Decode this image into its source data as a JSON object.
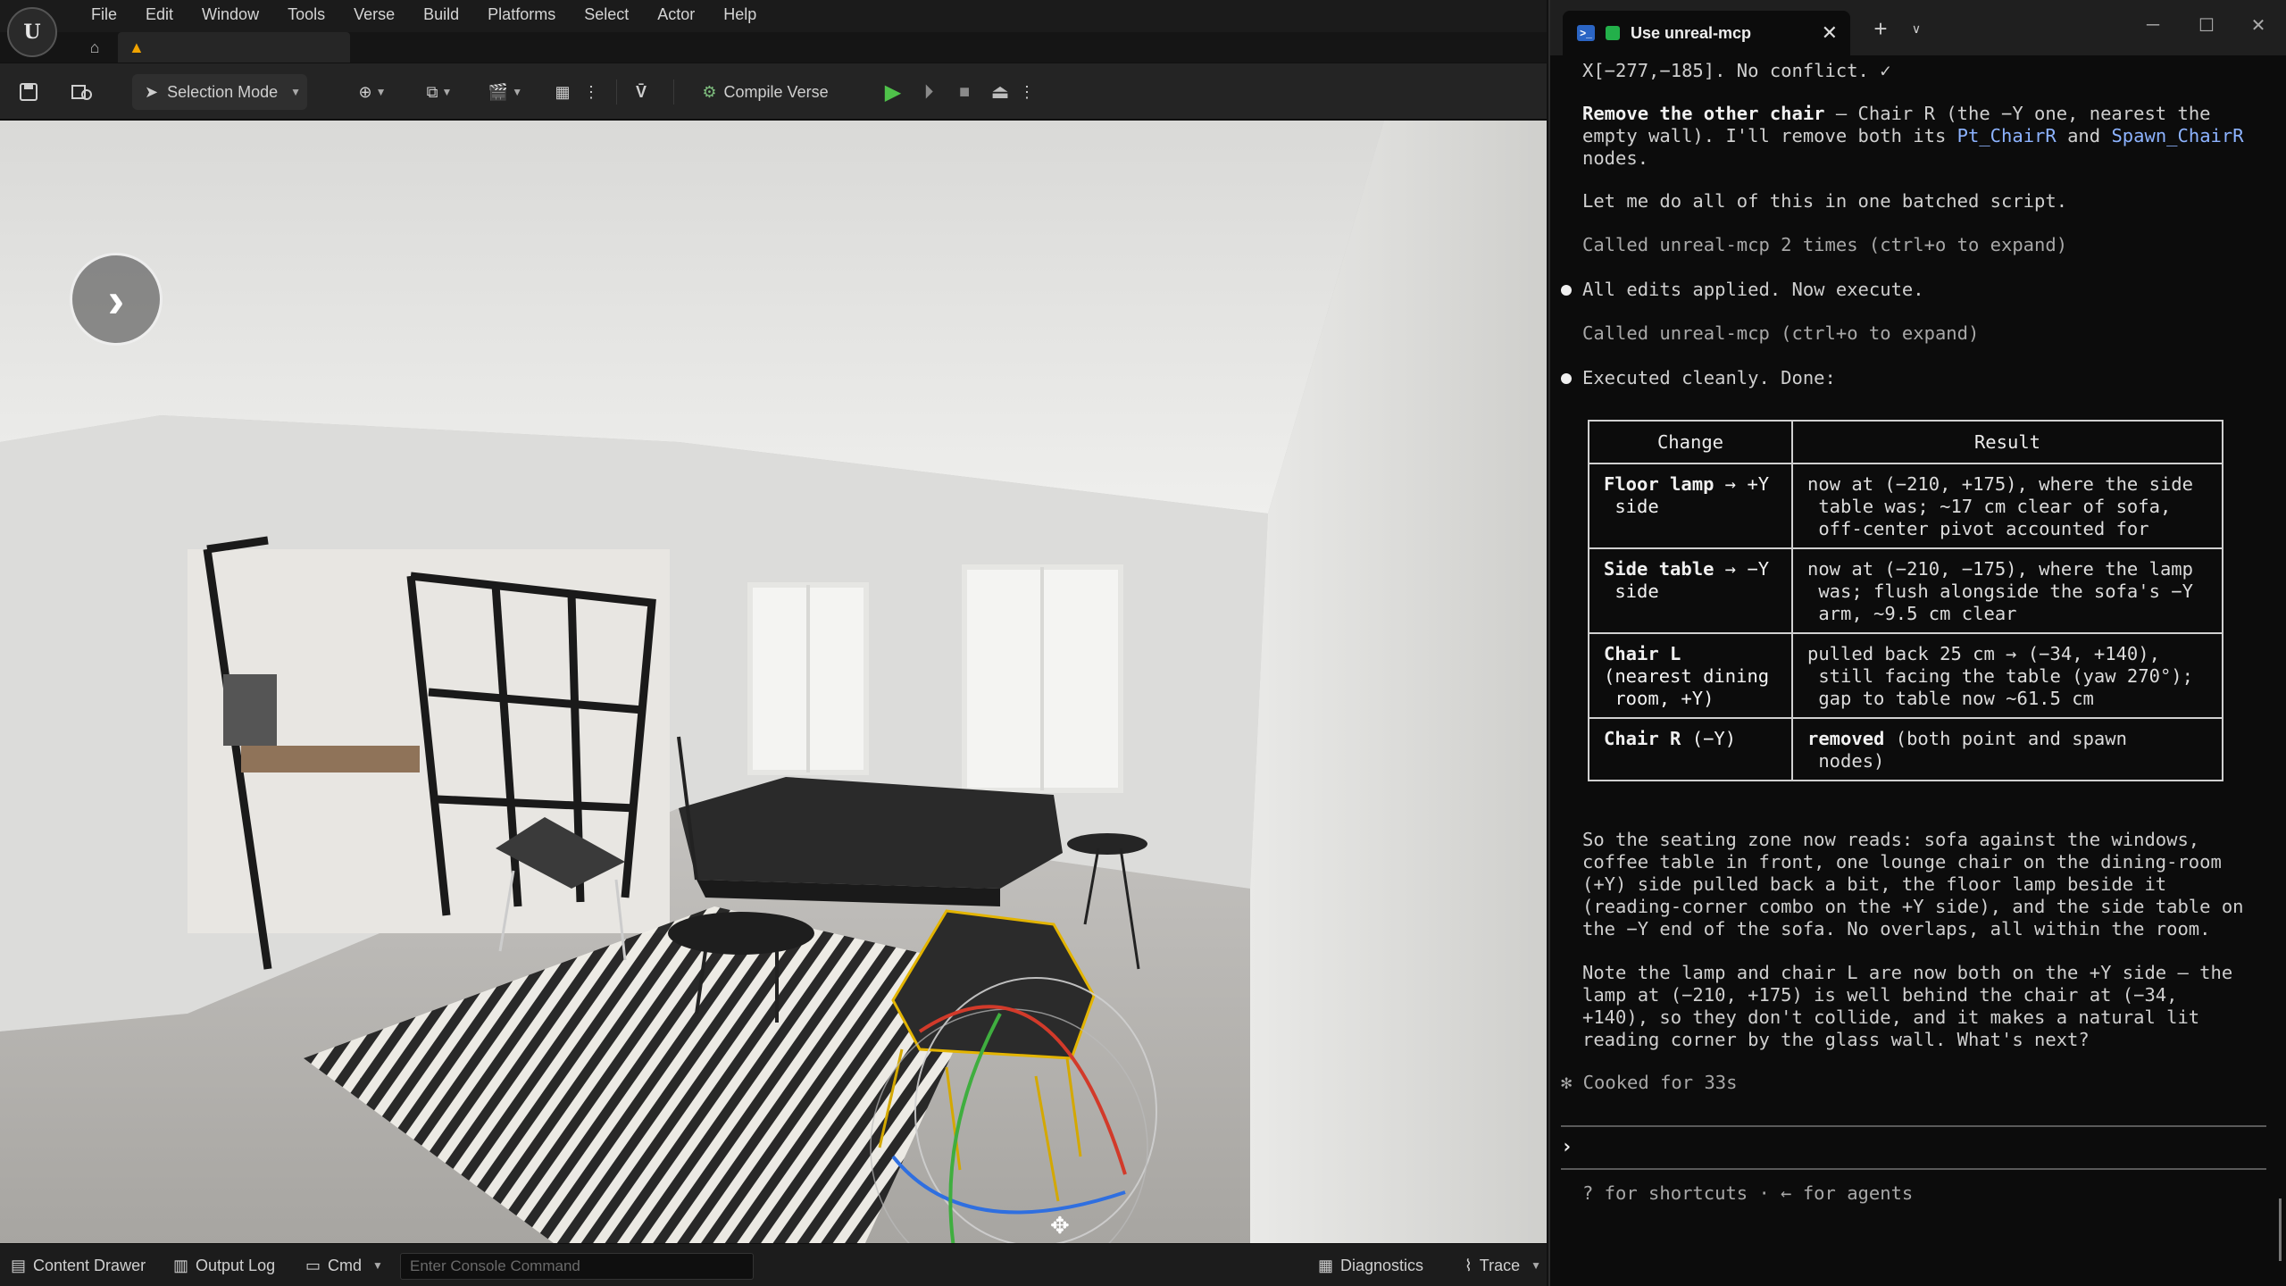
{
  "editor": {
    "logo_text": "U",
    "menu": [
      "File",
      "Edit",
      "Window",
      "Tools",
      "Verse",
      "Build",
      "Platforms",
      "Select",
      "Actor",
      "Help"
    ],
    "toolbar": {
      "selection_mode": "Selection Mode",
      "compile_verse": "Compile Verse"
    },
    "statusbar": {
      "content_drawer": "Content Drawer",
      "output_log": "Output Log",
      "cmd": "Cmd",
      "console_placeholder": "Enter Console Command",
      "diagnostics": "Diagnostics",
      "trace": "Trace"
    }
  },
  "terminal": {
    "tab_title": "Use unreal-mcp",
    "lines": {
      "l0": "X[−277,−185]. No conflict. ✓",
      "p1_head": "Remove the other chair",
      "p1_a": " — Chair R (the −Y one, nearest the",
      "p1_b_pre": "empty wall). I'll remove both its ",
      "p1_b_link1": "Pt_ChairR",
      "p1_b_mid": " and ",
      "p1_b_link2": "Spawn_ChairR",
      "p1_c": "nodes.",
      "p2": "Let me do all of this in one batched script.",
      "called1": "Called unreal-mcp 2 times (ctrl+o to expand)",
      "applied": "All edits applied. Now execute.",
      "called2": "Called unreal-mcp (ctrl+o to expand)",
      "executed": "Executed cleanly. Done:"
    },
    "table": {
      "headers": [
        "Change",
        "Result"
      ],
      "rows": [
        {
          "change_bold": "Floor lamp",
          "change_rest": " → +Y\n side",
          "result": "now at (−210, +175), where the side\n table was; ~17 cm clear of sofa,\n off-center pivot accounted for"
        },
        {
          "change_bold": "Side table",
          "change_rest": " → −Y\n side",
          "result": "now at (−210, −175), where the lamp\n was; flush alongside the sofa's −Y\n arm, ~9.5 cm clear"
        },
        {
          "change_bold": "Chair L",
          "change_rest": "\n(nearest dining\n room, +Y)",
          "result": "pulled back 25 cm → (−34, +140),\n still facing the table (yaw 270°);\n gap to table now ~61.5 cm"
        },
        {
          "change_bold": "Chair R",
          "change_rest": " (−Y)",
          "result_bold": "removed",
          "result": " (both point and spawn\n nodes)"
        }
      ]
    },
    "summary": [
      "So the seating zone now reads: sofa against the windows,",
      "coffee table in front, one lounge chair on the dining-room",
      "(+Y) side pulled back a bit, the floor lamp beside it",
      "(reading-corner combo on the +Y side), and the side table on",
      "the −Y end of the sofa. No overlaps, all within the room."
    ],
    "note": [
      "Note the lamp and chair L are now both on the +Y side — the",
      "lamp at (−210, +175) is well behind the chair at (−34,",
      "+140), so they don't collide, and it makes a natural lit",
      "reading corner by the glass wall. What's next?"
    ],
    "cooked": "✻ Cooked for 33s",
    "prompt": "›",
    "hint": "? for shortcuts · ← for agents"
  }
}
